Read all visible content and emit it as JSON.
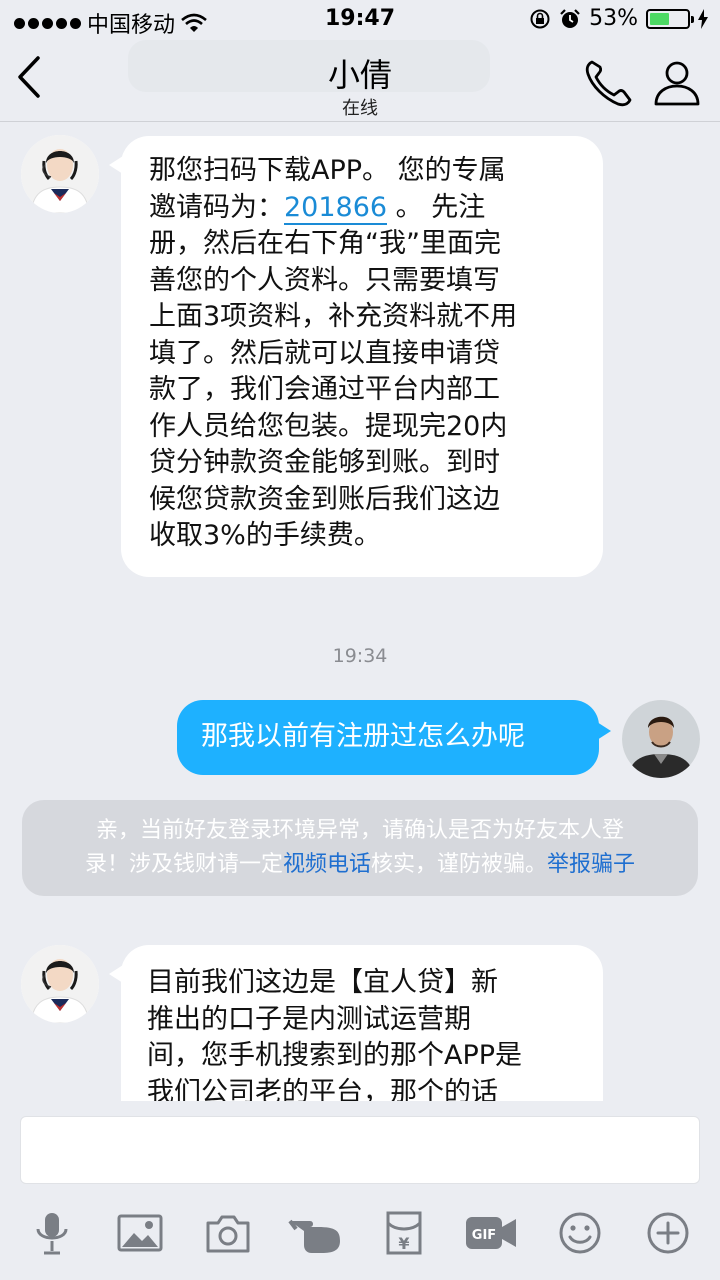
{
  "status_bar": {
    "carrier": "中国移动",
    "time": "19:47",
    "battery_percent": "53%",
    "battery_level": 0.53,
    "icons": [
      "signal-dots-icon",
      "wifi-icon",
      "rotation-lock-icon",
      "alarm-icon",
      "battery-icon",
      "charging-icon"
    ]
  },
  "nav": {
    "title": "小倩",
    "status": "在线",
    "icons": [
      "back-chevron-icon",
      "phone-icon",
      "user-profile-icon"
    ]
  },
  "messages": {
    "m1": {
      "line1": "那您扫码下载APP。 您的专属",
      "line2_prefix": "邀请码为：",
      "invite_code": "201866",
      "line2_suffix": " 。 先注",
      "line3": "册，然后在右下角“我”里面完",
      "line4": "善您的个人资料。只需要填写",
      "line5": "上面3项资料，补充资料就不用",
      "line6": "填了。然后就可以直接申请贷",
      "line7": "款了，我们会通过平台内部工",
      "line8": "作人员给您包装。提现完20内",
      "line9": "贷分钟款资金能够到账。到时",
      "line10": "候您贷款资金到账后我们这边",
      "line11": "收取3%的手续费。"
    },
    "timestamp": "19:34",
    "m2": {
      "text": "那我以前有注册过怎么办呢"
    },
    "notice": {
      "line1": "亲，当前好友登录环境异常，请确认是否为好友本人登",
      "line2_prefix": "录！涉及钱财请一定",
      "video_call": "视频电话",
      "line2_middle": "核实，谨防被骗。",
      "report": "举报骗子"
    },
    "m3": {
      "line1": "目前我们这边是【宜人贷】新",
      "line2": "推出的口子是内测试运营期",
      "line3": "间，您手机搜索到的那个APP是",
      "line4": "我们公司老的平台，那个的话"
    }
  },
  "input": {
    "value": ""
  },
  "toolbar": {
    "icons": [
      "microphone-icon",
      "image-icon",
      "camera-icon",
      "poke-hand-icon",
      "red-packet-icon",
      "gif-icon",
      "emoji-icon",
      "plus-icon"
    ]
  },
  "colors": {
    "background": "#ebedf2",
    "outgoing_bubble": "#1eb1ff",
    "incoming_bubble": "#ffffff",
    "link": "#1a8bd6",
    "notice_bg": "#d6d8dd",
    "notice_link": "#1f6fd0"
  }
}
